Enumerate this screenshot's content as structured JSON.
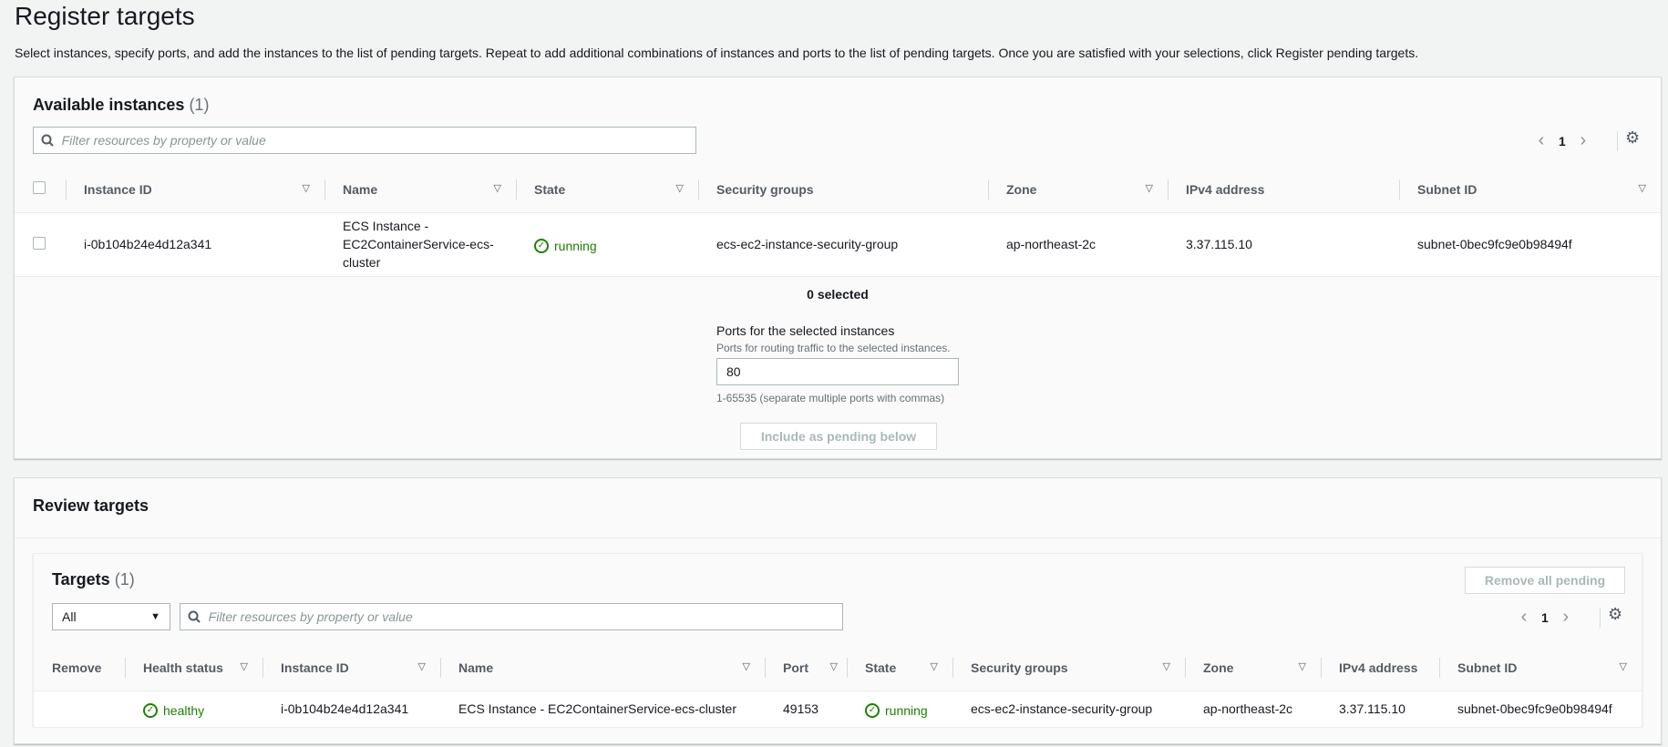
{
  "page": {
    "title": "Register targets",
    "description": "Select instances, specify ports, and add the instances to the list of pending targets. Repeat to add additional combinations of instances and ports to the list of pending targets. Once you are satisfied with your selections, click Register pending targets."
  },
  "available": {
    "title": "Available instances",
    "count": "(1)",
    "search_placeholder": "Filter resources by property or value",
    "page": "1",
    "columns": [
      "Instance ID",
      "Name",
      "State",
      "Security groups",
      "Zone",
      "IPv4 address",
      "Subnet ID"
    ],
    "rows": [
      {
        "instance_id": "i-0b104b24e4d12a341",
        "name": "ECS Instance - EC2ContainerService-ecs-cluster",
        "state": "running",
        "security_groups": "ecs-ec2-instance-security-group",
        "zone": "ap-northeast-2c",
        "ipv4": "3.37.115.10",
        "subnet": "subnet-0bec9fc9e0b98494f"
      }
    ],
    "selected_text": "0 selected",
    "ports_label": "Ports for the selected instances",
    "ports_sub": "Ports for routing traffic to the selected instances.",
    "ports_value": "80",
    "ports_hint": "1-65535 (separate multiple ports with commas)",
    "include_button": "Include as pending below"
  },
  "review": {
    "title": "Review targets",
    "targets_title": "Targets",
    "targets_count": "(1)",
    "remove_all_button": "Remove all pending",
    "filter_select": "All",
    "search_placeholder": "Filter resources by property or value",
    "page": "1",
    "columns": [
      "Remove",
      "Health status",
      "Instance ID",
      "Name",
      "Port",
      "State",
      "Security groups",
      "Zone",
      "IPv4 address",
      "Subnet ID"
    ],
    "rows": [
      {
        "health": "healthy",
        "instance_id": "i-0b104b24e4d12a341",
        "name": "ECS Instance - EC2ContainerService-ecs-cluster",
        "port": "49153",
        "state": "running",
        "security_groups": "ecs-ec2-instance-security-group",
        "zone": "ap-northeast-2c",
        "ipv4": "3.37.115.10",
        "subnet": "subnet-0bec9fc9e0b98494f"
      }
    ]
  },
  "colors": {
    "success": "#1d8102",
    "border": "#aab7b8"
  }
}
